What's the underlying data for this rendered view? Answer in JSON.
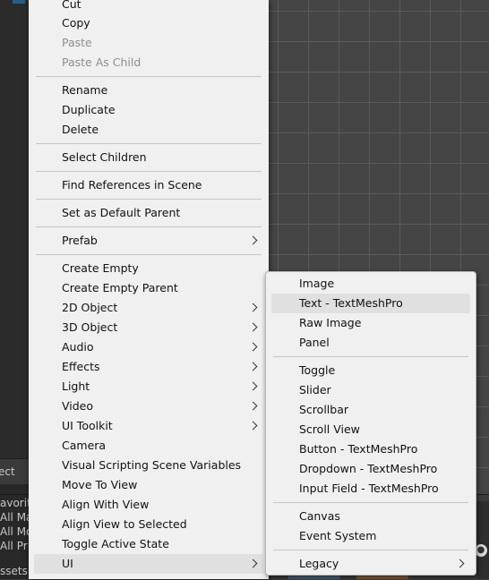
{
  "background": {
    "left_bar_label": "ect",
    "left_rows": [
      "avorit",
      "All Ma",
      "All Mo",
      "All Pr"
    ],
    "left_bottom_label": "ssets",
    "colors": {
      "scene_bg": "#454545",
      "grid": "#5a5a5a",
      "menu_bg": "#f0f0f0",
      "highlight": "#e0e0e0"
    }
  },
  "main_menu": {
    "items": [
      {
        "label": "Cut",
        "disabled": false
      },
      {
        "label": "Copy",
        "disabled": false
      },
      {
        "label": "Paste",
        "disabled": true
      },
      {
        "label": "Paste As Child",
        "disabled": true
      },
      {
        "label": "Rename"
      },
      {
        "label": "Duplicate"
      },
      {
        "label": "Delete"
      },
      {
        "label": "Select Children"
      },
      {
        "label": "Find References in Scene"
      },
      {
        "label": "Set as Default Parent"
      },
      {
        "label": "Prefab",
        "submenu": true
      },
      {
        "label": "Create Empty"
      },
      {
        "label": "Create Empty Parent"
      },
      {
        "label": "2D Object",
        "submenu": true
      },
      {
        "label": "3D Object",
        "submenu": true
      },
      {
        "label": "Audio",
        "submenu": true
      },
      {
        "label": "Effects",
        "submenu": true
      },
      {
        "label": "Light",
        "submenu": true
      },
      {
        "label": "Video",
        "submenu": true
      },
      {
        "label": "UI Toolkit",
        "submenu": true
      },
      {
        "label": "Camera"
      },
      {
        "label": "Visual Scripting Scene Variables"
      },
      {
        "label": "Move To View"
      },
      {
        "label": "Align With View"
      },
      {
        "label": "Align View to Selected"
      },
      {
        "label": "Toggle Active State"
      },
      {
        "label": "UI",
        "submenu": true,
        "highlighted": true
      }
    ]
  },
  "ui_submenu": {
    "items": [
      {
        "label": "Image"
      },
      {
        "label": "Text - TextMeshPro",
        "highlighted": true
      },
      {
        "label": "Raw Image"
      },
      {
        "label": "Panel"
      },
      {
        "label": "Toggle"
      },
      {
        "label": "Slider"
      },
      {
        "label": "Scrollbar"
      },
      {
        "label": "Scroll View"
      },
      {
        "label": "Button - TextMeshPro"
      },
      {
        "label": "Dropdown - TextMeshPro"
      },
      {
        "label": "Input Field - TextMeshPro"
      },
      {
        "label": "Canvas"
      },
      {
        "label": "Event System"
      },
      {
        "label": "Legacy",
        "submenu": true
      }
    ]
  }
}
